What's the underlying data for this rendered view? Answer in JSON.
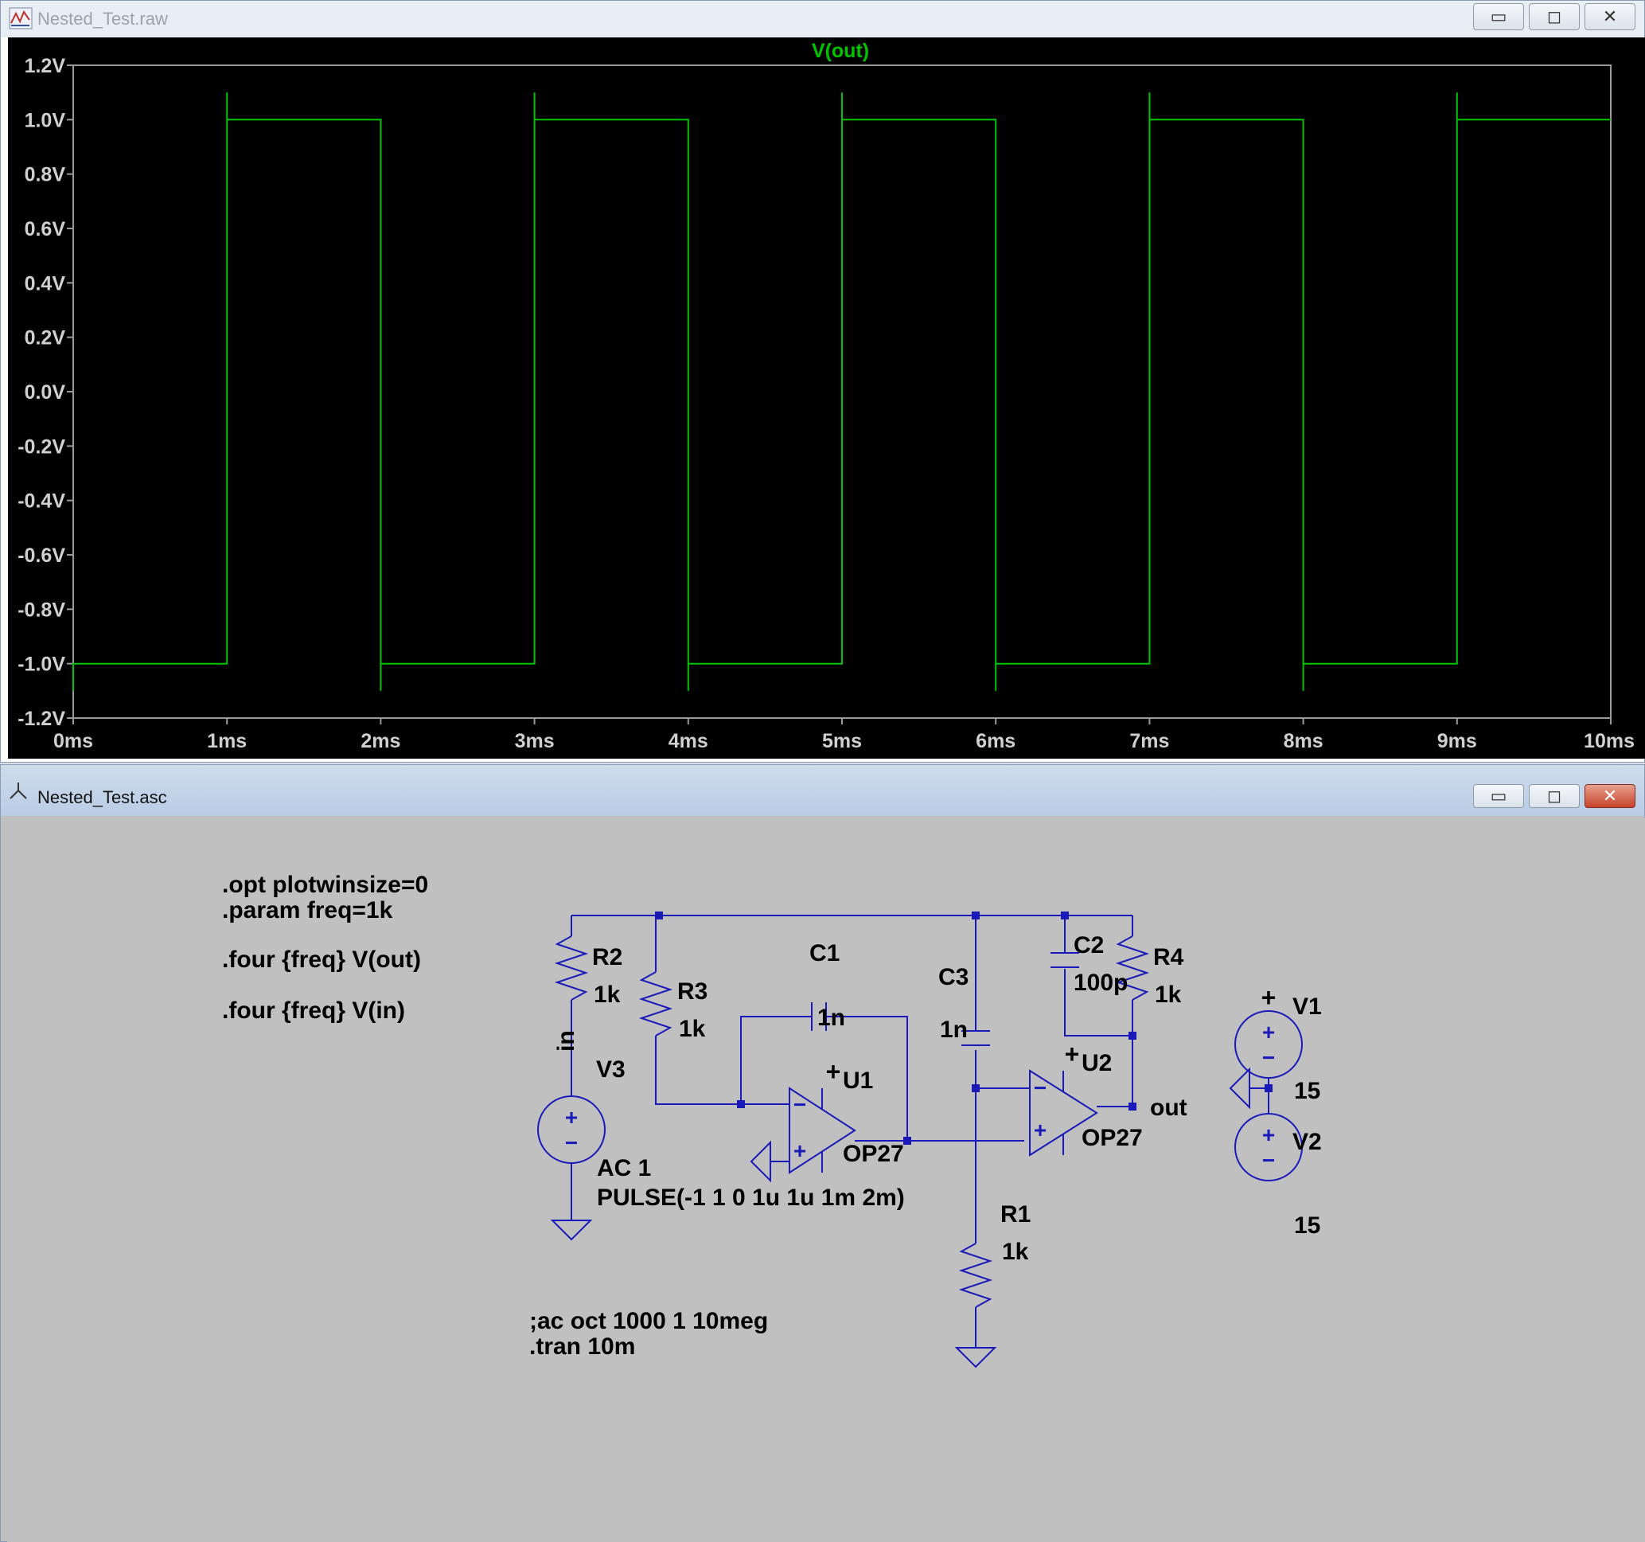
{
  "plot_window": {
    "title": "Nested_Test.raw",
    "buttons": {
      "minimize": "▭",
      "maximize": "◻",
      "close": "✕"
    }
  },
  "schematic_window": {
    "title": "Nested_Test.asc",
    "buttons": {
      "minimize": "▭",
      "maximize": "◻",
      "close": "✕"
    }
  },
  "colors": {
    "trace": "#00c400",
    "plot_bg": "#000000",
    "wire": "#1a1ab8",
    "schematic_bg": "#c0c0c0"
  },
  "chart_data": {
    "type": "line",
    "title": "V(out)",
    "xlabel": "",
    "ylabel": "",
    "xlim": [
      0,
      10
    ],
    "ylim": [
      -1.2,
      1.2
    ],
    "x_ticks": [
      "0ms",
      "1ms",
      "2ms",
      "3ms",
      "4ms",
      "5ms",
      "6ms",
      "7ms",
      "8ms",
      "9ms",
      "10ms"
    ],
    "y_ticks": [
      "1.2V",
      "1.0V",
      "0.8V",
      "0.6V",
      "0.4V",
      "0.2V",
      "0.0V",
      "-0.2V",
      "-0.4V",
      "-0.6V",
      "-0.8V",
      "-1.0V",
      "-1.2V"
    ],
    "series": [
      {
        "name": "V(out)",
        "x": [
          0,
          0.0,
          1.0,
          1.0,
          1.0,
          2.0,
          2.0,
          2.0,
          3.0,
          3.0,
          3.0,
          4.0,
          4.0,
          4.0,
          5.0,
          5.0,
          5.0,
          6.0,
          6.0,
          6.0,
          7.0,
          7.0,
          7.0,
          8.0,
          8.0,
          8.0,
          9.0,
          9.0,
          9.0,
          10.0
        ],
        "y": [
          -1.1,
          -1.0,
          -1.0,
          1.1,
          1.0,
          1.0,
          -1.1,
          -1.0,
          -1.0,
          1.1,
          1.0,
          1.0,
          -1.1,
          -1.0,
          -1.0,
          1.1,
          1.0,
          1.0,
          -1.1,
          -1.0,
          -1.0,
          1.1,
          1.0,
          1.0,
          -1.1,
          -1.0,
          -1.0,
          1.1,
          1.0,
          1.0
        ]
      }
    ],
    "grid": false,
    "legend": "none"
  },
  "schematic": {
    "directives": {
      "opt": ".opt plotwinsize=0",
      "param": ".param freq=1k",
      "four_out": ".four {freq} V(out)",
      "four_in": ".four {freq} V(in)",
      "ac": ";ac oct 1000 1 10meg",
      "tran": ".tran 10m"
    },
    "R2": {
      "name": "R2",
      "value": "1k"
    },
    "R3": {
      "name": "R3",
      "value": "1k"
    },
    "R4": {
      "name": "R4",
      "value": "1k"
    },
    "R1": {
      "name": "R1",
      "value": "1k"
    },
    "C1": {
      "name": "C1",
      "value": "1n"
    },
    "C2": {
      "name": "C2",
      "value": "100p"
    },
    "C3": {
      "name": "C3",
      "value": "1n"
    },
    "U1": {
      "name": "U1",
      "model": "OP27"
    },
    "U2": {
      "name": "U2",
      "model": "OP27"
    },
    "V3": {
      "name": "V3",
      "ac": "AC 1",
      "value": "PULSE(-1 1 0 1u 1u 1m 2m)"
    },
    "V1": {
      "name": "V1",
      "value": "15"
    },
    "V2": {
      "name": "V2",
      "value": "15"
    },
    "net_in": "in",
    "net_out": "out",
    "signs": {
      "plus": "+",
      "minus": "−"
    }
  }
}
